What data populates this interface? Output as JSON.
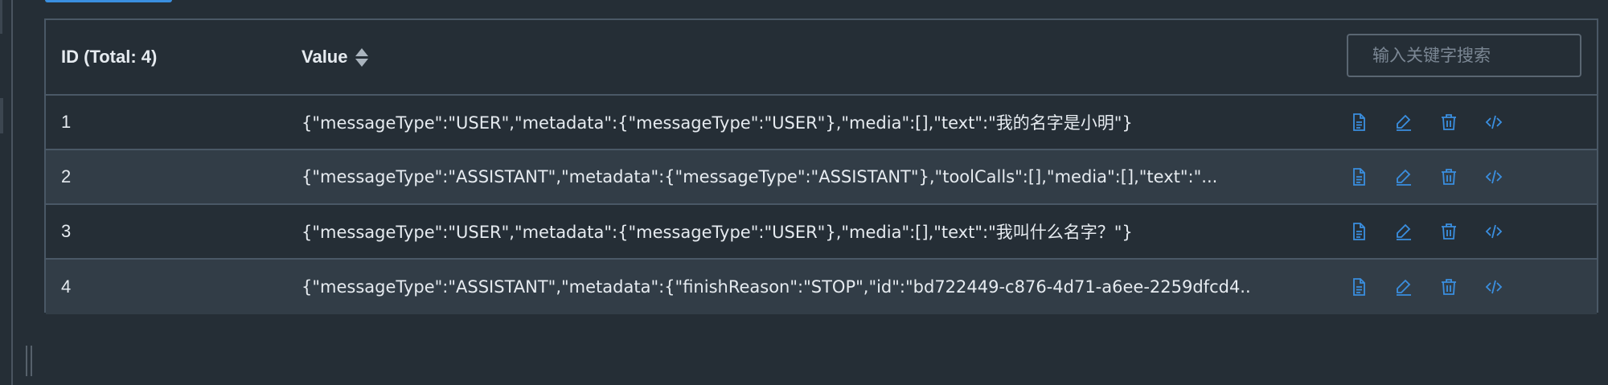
{
  "table": {
    "header": {
      "id_label": "ID (Total: 4)",
      "value_label": "Value"
    },
    "search": {
      "placeholder": "输入关键字搜索"
    },
    "rows": [
      {
        "id": "1",
        "value": "{\"messageType\":\"USER\",\"metadata\":{\"messageType\":\"USER\"},\"media\":[],\"text\":\"我的名字是小明\"}"
      },
      {
        "id": "2",
        "value": "{\"messageType\":\"ASSISTANT\",\"metadata\":{\"messageType\":\"ASSISTANT\"},\"toolCalls\":[],\"media\":[],\"text\":\"..."
      },
      {
        "id": "3",
        "value": "{\"messageType\":\"USER\",\"metadata\":{\"messageType\":\"USER\"},\"media\":[],\"text\":\"我叫什么名字？\"}"
      },
      {
        "id": "4",
        "value": "{\"messageType\":\"ASSISTANT\",\"metadata\":{\"finishReason\":\"STOP\",\"id\":\"bd722449-c876-4d71-a6ee-2259dfcd4..."
      }
    ],
    "actions": [
      "document-icon",
      "edit-icon",
      "delete-icon",
      "code-icon"
    ]
  },
  "colors": {
    "background": "#252e36",
    "row_alt": "#323d47",
    "border": "#4a5866",
    "accent": "#3a8fe0"
  }
}
